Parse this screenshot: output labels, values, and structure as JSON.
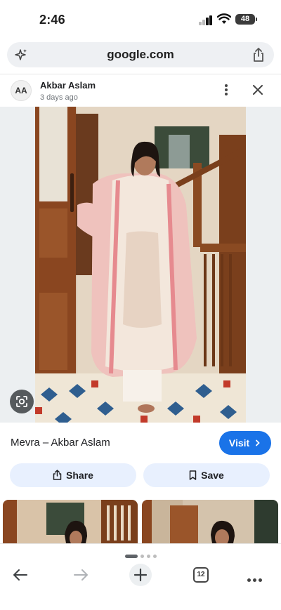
{
  "status_bar": {
    "time": "2:46",
    "battery": "48"
  },
  "browser": {
    "url": "google.com"
  },
  "post": {
    "author": "Akbar Aslam",
    "avatar_text": "AA",
    "time_ago": "3 days ago"
  },
  "product": {
    "title": "Mevra – Akbar Aslam",
    "visit_label": "Visit"
  },
  "actions": {
    "share_label": "Share",
    "save_label": "Save"
  },
  "bottom_nav": {
    "tab_count": "12"
  },
  "colors": {
    "accent": "#1a73e8",
    "action_bg": "#e8f0fe",
    "url_bar_bg": "#eef0f3"
  },
  "icons": [
    "sparkle-icon",
    "share-icon",
    "more-vert-icon",
    "close-icon",
    "lens-icon",
    "chevron-right-icon",
    "bookmark-icon",
    "back-arrow-icon",
    "forward-arrow-icon",
    "plus-icon",
    "tabs-icon",
    "more-horiz-icon"
  ]
}
